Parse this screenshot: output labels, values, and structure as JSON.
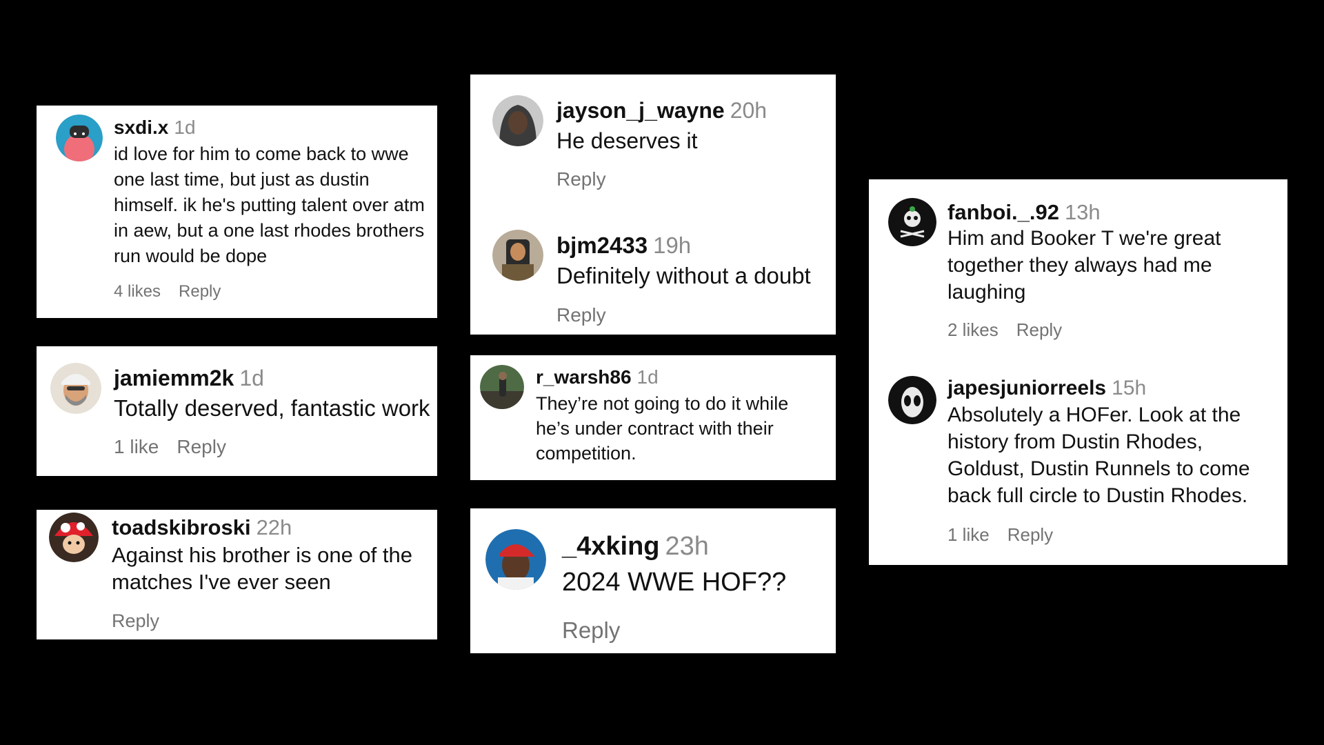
{
  "comments": {
    "sxdi": {
      "username": "sxdi.x",
      "time": "1d",
      "text": "id love for him to come back to wwe one last time, but just as dustin himself. ik he's putting talent over atm in aew, but a one last rhodes brothers run would be dope",
      "likes": "4 likes",
      "reply": "Reply"
    },
    "jamiemm": {
      "username": "jamiemm2k",
      "time": "1d",
      "text": "Totally deserved, fantastic work",
      "likes": "1 like",
      "reply": "Reply"
    },
    "toad": {
      "username": "toadskibroski",
      "time": "22h",
      "text": "Against his brother is one of the matches I've ever seen",
      "reply": "Reply"
    },
    "jayson": {
      "username": "jayson_j_wayne",
      "time": "20h",
      "text": "He deserves it",
      "reply": "Reply"
    },
    "bjm": {
      "username": "bjm2433",
      "time": "19h",
      "text": "Definitely without a doubt",
      "reply": "Reply"
    },
    "warsh": {
      "username": "r_warsh86",
      "time": "1d",
      "text": "They’re not going to do it while he’s under contract with their competition."
    },
    "king": {
      "username": "_4xking",
      "time": "23h",
      "text": "2024 WWE HOF??",
      "reply": "Reply"
    },
    "fanboi": {
      "username": "fanboi._.92",
      "time": "13h",
      "text": "Him and Booker T we're great together they always had me laughing",
      "likes": "2 likes",
      "reply": "Reply"
    },
    "japes": {
      "username": "japesjuniorreels",
      "time": "15h",
      "text": "Absolutely a HOFer. Look at the history from Dustin Rhodes, Goldust, Dustin Runnels to come back full circle to Dustin Rhodes.",
      "likes": "1 like",
      "reply": "Reply"
    }
  },
  "icons": {
    "sxdi": "avatar-cartoon-pink-icon",
    "jamiemm": "avatar-bearded-man-icon",
    "toad": "avatar-toad-icon",
    "jayson": "avatar-hooded-person-icon",
    "bjm": "avatar-selfie-icon",
    "warsh": "avatar-outdoor-icon",
    "king": "avatar-red-cap-icon",
    "fanboi": "avatar-skull-logo-icon",
    "japes": "avatar-alien-logo-icon"
  },
  "colors": {
    "background": "#000000",
    "card": "#ffffff",
    "timestamp": "#8a8a8a",
    "meta": "#737373"
  }
}
